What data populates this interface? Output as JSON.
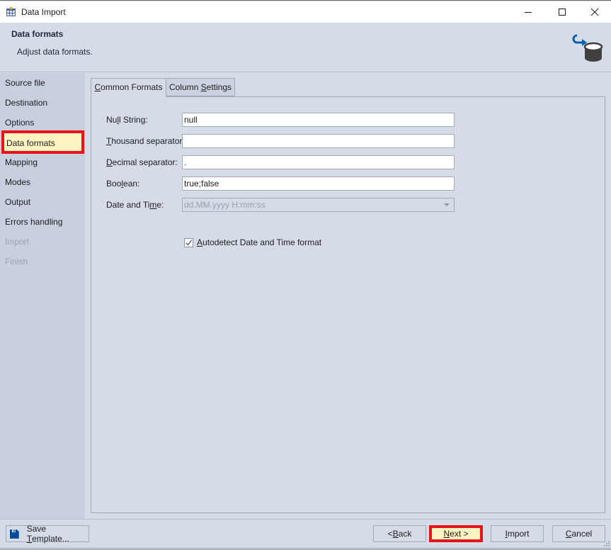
{
  "window": {
    "title": "Data Import",
    "icon": "calendar-table-icon",
    "controls": {
      "minimize": "minimize-icon",
      "maximize": "maximize-icon",
      "close": "close-icon"
    }
  },
  "header": {
    "title": "Data formats",
    "subtitle": "Adjust data formats.",
    "icon": "database-import-icon",
    "accent_color": "#0062b1"
  },
  "sidebar": {
    "items": [
      {
        "label": "Source file",
        "state": "normal"
      },
      {
        "label": "Destination",
        "state": "normal"
      },
      {
        "label": "Options",
        "state": "normal"
      },
      {
        "label": "Data formats",
        "state": "active"
      },
      {
        "label": "Mapping",
        "state": "normal"
      },
      {
        "label": "Modes",
        "state": "normal"
      },
      {
        "label": "Output",
        "state": "normal"
      },
      {
        "label": "Errors handling",
        "state": "normal"
      },
      {
        "label": "Import",
        "state": "disabled"
      },
      {
        "label": "Finish",
        "state": "disabled"
      }
    ]
  },
  "tabs": [
    {
      "label_u": "C",
      "label_rest": "ommon Formats",
      "active": true
    },
    {
      "label_pre": "Column ",
      "label_u": "S",
      "label_rest": "ettings",
      "active": false
    }
  ],
  "form": {
    "null_string": {
      "pre": "Nu",
      "u": "l",
      "post": "l String:",
      "value": "null"
    },
    "thousand_separator": {
      "pre": "",
      "u": "T",
      "post": "housand separator:",
      "value": ""
    },
    "decimal_separator": {
      "pre": "",
      "u": "D",
      "post": "ecimal separator:",
      "value": "."
    },
    "boolean": {
      "pre": "Boo",
      "u": "l",
      "post": "ean:",
      "value": "true;false"
    },
    "date_time": {
      "pre": "Date and Ti",
      "u": "m",
      "post": "e:",
      "value": "dd.MM.yyyy H:mm:ss",
      "disabled": true
    },
    "autodetect": {
      "u": "A",
      "post": "utodetect Date and Time format",
      "checked": true
    }
  },
  "footer": {
    "save_template": {
      "pre": "Save ",
      "u": "T",
      "post": "emplate...",
      "icon": "floppy-disk-icon"
    },
    "back": {
      "pre": "< ",
      "u": "B",
      "post": "ack"
    },
    "next": {
      "pre": "",
      "u": "N",
      "post": "ext >"
    },
    "import": {
      "pre": "",
      "u": "I",
      "post": "mport"
    },
    "cancel": {
      "pre": "",
      "u": "C",
      "post": "ancel"
    }
  },
  "colors": {
    "highlight_border": "#e8141c",
    "highlight_fill": "#fef4c2",
    "background": "#d5dbe7",
    "sidebar": "#c8cfde"
  }
}
